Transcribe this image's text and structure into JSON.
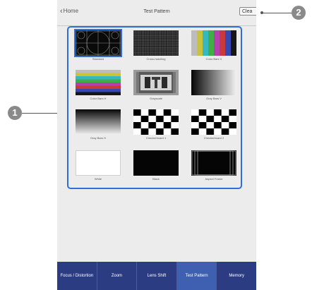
{
  "header": {
    "back_label": "Home",
    "title": "Test Pattern",
    "clear_label": "Clea"
  },
  "callouts": {
    "one": "1",
    "two": "2"
  },
  "patterns": [
    {
      "label": "Standard",
      "selected": true
    },
    {
      "label": "Cross-hatching"
    },
    {
      "label": "Color Bars V"
    },
    {
      "label": "Color Bars H"
    },
    {
      "label": "Grayscale"
    },
    {
      "label": "Gray Bars V"
    },
    {
      "label": "Gray Bars H"
    },
    {
      "label": "Checkerboard 1"
    },
    {
      "label": "Checkerboard 2"
    },
    {
      "label": "White"
    },
    {
      "label": "Black"
    },
    {
      "label": "Aspect Frame"
    }
  ],
  "tabs": [
    {
      "label": "Focus / Distortion"
    },
    {
      "label": "Zoom"
    },
    {
      "label": "Lens Shift"
    },
    {
      "label": "Test Pattern",
      "active": true
    },
    {
      "label": "Memory"
    }
  ],
  "colors": {
    "accent": "#2d6fd6",
    "tabbar": "#2c3c82",
    "tab_active": "#3f5fb0"
  }
}
